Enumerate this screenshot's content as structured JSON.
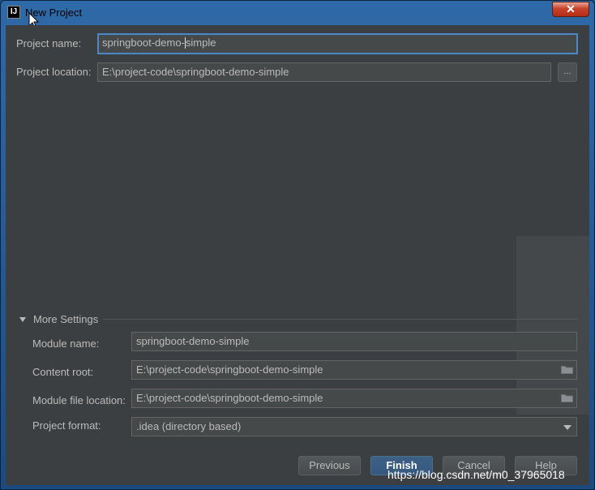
{
  "window": {
    "title": "New Project",
    "close_glyph": "✕",
    "app_icon_text": "IJ"
  },
  "project": {
    "name_label": "Project name:",
    "name_value_before_caret": "springboot-demo-",
    "name_value_after_caret": "simple",
    "location_label": "Project location:",
    "location_value": "E:\\project-code\\springboot-demo-simple",
    "browse_label": "..."
  },
  "more_settings": {
    "title": "More Settings",
    "module_name_label": "Module name:",
    "module_name_value": "springboot-demo-simple",
    "content_root_label": "Content root:",
    "content_root_value": "E:\\project-code\\springboot-demo-simple",
    "module_file_label": "Module file location:",
    "module_file_value": "E:\\project-code\\springboot-demo-simple",
    "format_label": "Project format:",
    "format_value": ".idea (directory based)"
  },
  "buttons": {
    "previous": "Previous",
    "finish": "Finish",
    "cancel": "Cancel",
    "help": "Help"
  },
  "watermark": "https://blog.csdn.net/m0_37965018",
  "icons": [
    "intellij-app-icon",
    "close-icon",
    "mouse-cursor-icon",
    "folder-icon",
    "chevron-down-icon",
    "collapse-triangle-icon"
  ],
  "colors": {
    "background": "#3c3f41",
    "field": "#45494a",
    "focus_border": "#4a88c7",
    "primary_button": "#365880",
    "close_button": "#c7422b"
  }
}
